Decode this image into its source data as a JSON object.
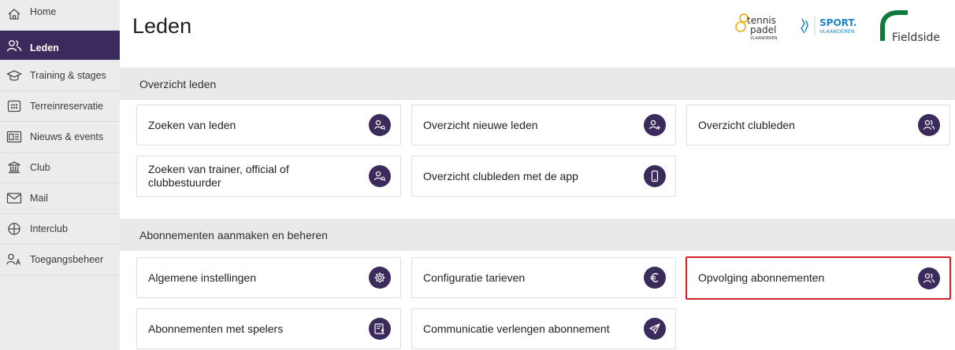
{
  "sidebar": {
    "items": [
      {
        "label": "Home",
        "icon": "home-icon"
      },
      {
        "label": "Leden",
        "icon": "users-icon",
        "active": true
      },
      {
        "label": "Training & stages",
        "icon": "graduation-cap-icon"
      },
      {
        "label": "Terreinreservatie",
        "icon": "calendar-icon"
      },
      {
        "label": "Nieuws & events",
        "icon": "newspaper-icon"
      },
      {
        "label": "Club",
        "icon": "building-icon"
      },
      {
        "label": "Mail",
        "icon": "mail-icon"
      },
      {
        "label": "Interclub",
        "icon": "crosshair-icon"
      },
      {
        "label": "Toegangsbeheer",
        "icon": "access-icon"
      }
    ]
  },
  "header": {
    "title": "Leden",
    "logos": {
      "tennis": {
        "line1": "tennis",
        "line2": "padel",
        "line3": "VLAANDEREN"
      },
      "sport": {
        "line1": "SPORT.",
        "line2": "VLAANDEREN"
      },
      "fieldside": "Fieldside"
    }
  },
  "sections": [
    {
      "title": "Overzicht leden",
      "cards": [
        {
          "label": "Zoeken van leden",
          "icon": "user-search-icon"
        },
        {
          "label": "Overzicht nieuwe leden",
          "icon": "user-plus-icon"
        },
        {
          "label": "Overzicht clubleden",
          "icon": "users-icon"
        },
        {
          "label": "Zoeken van trainer, official of clubbestuurder",
          "icon": "user-search-icon"
        },
        {
          "label": "Overzicht clubleden met de app",
          "icon": "phone-icon"
        }
      ]
    },
    {
      "title": "Abonnementen aanmaken en beheren",
      "cards": [
        {
          "label": "Algemene instellingen",
          "icon": "gear-icon"
        },
        {
          "label": "Configuratie tarieven",
          "icon": "euro-icon"
        },
        {
          "label": "Opvolging abonnementen",
          "icon": "users-icon",
          "highlighted": true
        },
        {
          "label": "Abonnementen met spelers",
          "icon": "document-user-icon"
        },
        {
          "label": "Communicatie verlengen abonnement",
          "icon": "send-icon"
        }
      ]
    }
  ],
  "colors": {
    "accent": "#3b2a5c",
    "highlight": "#d32026",
    "sidebar_bg": "#ececec",
    "section_bg": "#e9e9e9",
    "tennis_orange": "#f2a900",
    "sport_blue": "#1f86c7",
    "fieldside_green": "#0b7a3b"
  }
}
